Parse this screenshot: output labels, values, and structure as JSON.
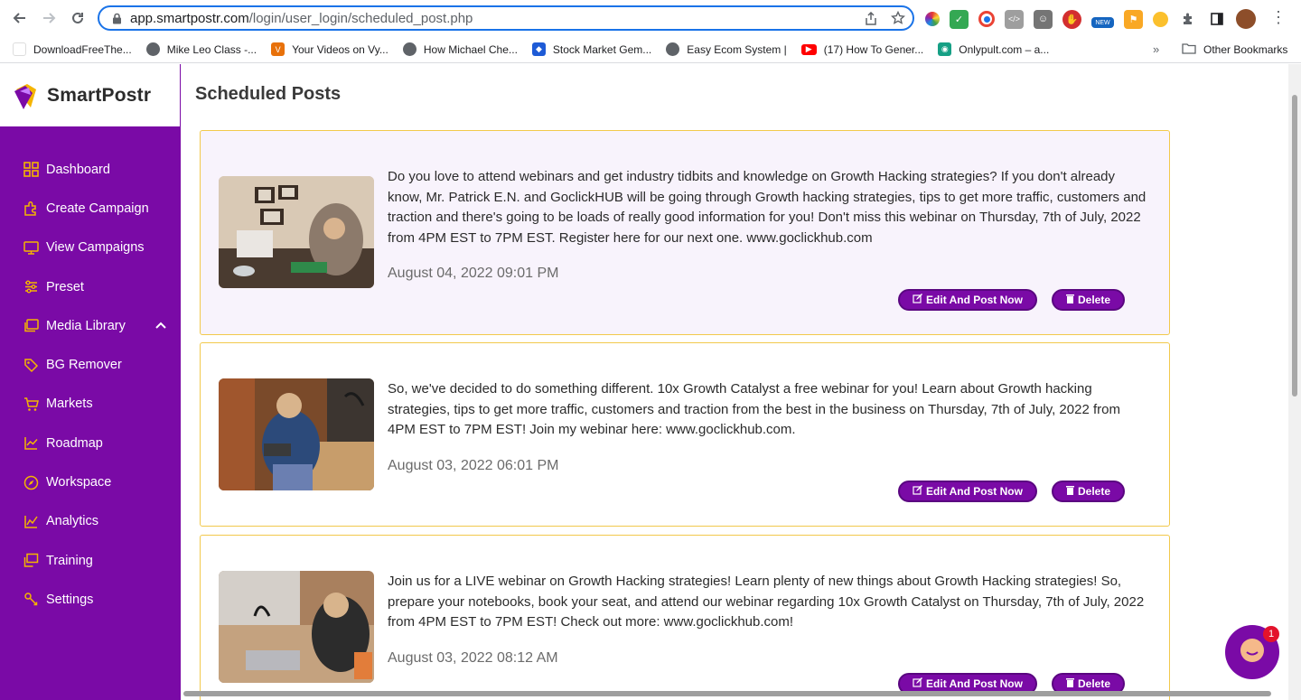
{
  "browser": {
    "url_host": "app.smartpostr.com",
    "url_path": "/login/user_login/scheduled_post.php",
    "extensions": [
      {
        "name": "color-wheel-icon",
        "color": "#e91e63"
      },
      {
        "name": "mail-check-icon",
        "color": "#34a853"
      },
      {
        "name": "chrome-circle-icon",
        "color": "#1a73e8"
      },
      {
        "name": "code-icon",
        "color": "#9e9e9e"
      },
      {
        "name": "face-icon",
        "color": "#757575"
      },
      {
        "name": "hand-icon",
        "color": "#d32f2f"
      },
      {
        "name": "new-badge-icon",
        "color": "#1565c0"
      },
      {
        "name": "flag-icon",
        "color": "#f9a825"
      },
      {
        "name": "sun-icon",
        "color": "#fbc02d"
      }
    ],
    "bookmarks": [
      {
        "label": "DownloadFreeThe...",
        "icon": "globe-icon",
        "color": "#ffffff"
      },
      {
        "label": "Mike Leo Class -...",
        "icon": "globe-icon",
        "color": "#5f6368"
      },
      {
        "label": "Your Videos on Vy...",
        "icon": "v-icon",
        "color": "#e8710a"
      },
      {
        "label": "How Michael Che...",
        "icon": "globe-icon",
        "color": "#5f6368"
      },
      {
        "label": "Stock Market Gem...",
        "icon": "dropbox-icon",
        "color": "#1e5bd6"
      },
      {
        "label": "Easy Ecom System |",
        "icon": "globe-icon",
        "color": "#5f6368"
      },
      {
        "label": "(17) How To Gener...",
        "icon": "youtube-icon",
        "color": "#ff0000"
      },
      {
        "label": "Onlypult.com – a...",
        "icon": "camera-icon",
        "color": "#16a085"
      }
    ],
    "bookmarks_more": "»",
    "other_bookmarks": "Other Bookmarks"
  },
  "app": {
    "brand": "SmartPostr",
    "brand_color": "#7a0aa6",
    "page_title": "Scheduled Posts"
  },
  "sidebar": {
    "items": [
      {
        "label": "Dashboard",
        "icon": "grid-icon"
      },
      {
        "label": "Create Campaign",
        "icon": "puzzle-icon"
      },
      {
        "label": "View Campaigns",
        "icon": "monitor-icon"
      },
      {
        "label": "Preset",
        "icon": "sliders-icon"
      },
      {
        "label": "Media Library",
        "icon": "images-icon",
        "expanded": true
      },
      {
        "label": "BG Remover",
        "icon": "tag-icon"
      },
      {
        "label": "Markets",
        "icon": "cart-icon"
      },
      {
        "label": "Roadmap",
        "icon": "chart-line-icon"
      },
      {
        "label": "Workspace",
        "icon": "compass-icon"
      },
      {
        "label": "Analytics",
        "icon": "analytics-icon"
      },
      {
        "label": "Training",
        "icon": "presentation-icon"
      },
      {
        "label": "Settings",
        "icon": "settings-icon"
      }
    ]
  },
  "posts": [
    {
      "text": "Do you love to attend webinars and get industry tidbits and knowledge on Growth Hacking strategies? If you don't already know, Mr. Patrick E.N. and GoclickHUB will be going through Growth hacking strategies, tips to get more traffic, customers and traction and there's going to be loads of really good information for you! Don't miss this webinar on Thursday, 7th of July, 2022 from 4PM EST to 7PM EST. Register here for our next one. www.goclickhub.com",
      "date": "August 04, 2022 09:01 PM",
      "edit_label": "Edit And Post Now",
      "delete_label": "Delete"
    },
    {
      "text": "So, we've decided to do something different. 10x Growth Catalyst a free webinar for you! Learn about Growth hacking strategies, tips to get more traffic, customers and traction from the best in the business on Thursday, 7th of July, 2022 from 4PM EST to 7PM EST! Join my webinar here: www.goclickhub.com.",
      "date": "August 03, 2022 06:01 PM",
      "edit_label": "Edit And Post Now",
      "delete_label": "Delete"
    },
    {
      "text": "Join us for a LIVE webinar on Growth Hacking strategies! Learn plenty of new things about Growth Hacking strategies! So, prepare your notebooks, book your seat, and attend our webinar regarding 10x Growth Catalyst on Thursday, 7th of July, 2022 from 4PM EST to 7PM EST! Check out more: www.goclickhub.com!",
      "date": "August 03, 2022 08:12 AM",
      "edit_label": "Edit And Post Now",
      "delete_label": "Delete"
    }
  ],
  "chat": {
    "badge_count": "1"
  }
}
